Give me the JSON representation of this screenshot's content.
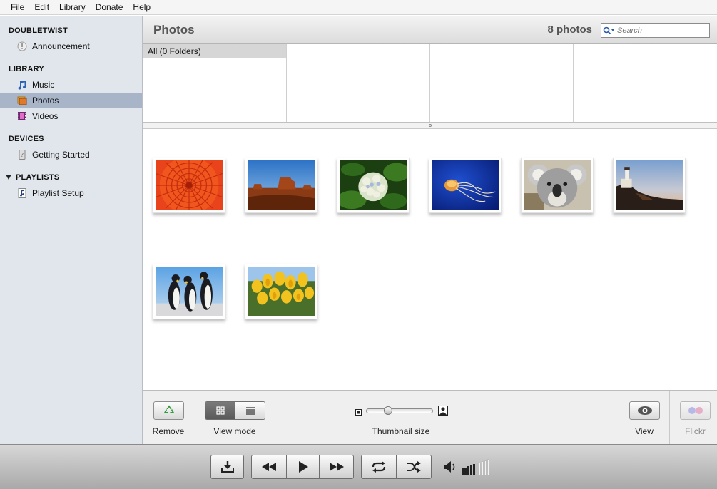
{
  "menu": [
    "File",
    "Edit",
    "Library",
    "Donate",
    "Help"
  ],
  "sidebar": {
    "sections": [
      {
        "title": "DOUBLETWIST",
        "items": [
          {
            "label": "Announcement",
            "icon": "announcement-icon"
          }
        ]
      },
      {
        "title": "LIBRARY",
        "items": [
          {
            "label": "Music",
            "icon": "music-note-icon"
          },
          {
            "label": "Photos",
            "icon": "photos-icon",
            "active": true
          },
          {
            "label": "Videos",
            "icon": "film-icon"
          }
        ]
      },
      {
        "title": "DEVICES",
        "items": [
          {
            "label": "Getting Started",
            "icon": "device-question-icon"
          }
        ]
      },
      {
        "title": "PLAYLISTS",
        "collapsible": true,
        "items": [
          {
            "label": "Playlist Setup",
            "icon": "playlist-icon"
          }
        ]
      }
    ]
  },
  "header": {
    "title": "Photos",
    "count": "8 photos",
    "search_placeholder": "Search"
  },
  "browser": {
    "first_row": "All (0 Folders)"
  },
  "photos": [
    {
      "subject": "orange-flower"
    },
    {
      "subject": "desert-butte"
    },
    {
      "subject": "hydrangea"
    },
    {
      "subject": "jellyfish"
    },
    {
      "subject": "koala"
    },
    {
      "subject": "lighthouse"
    },
    {
      "subject": "penguins"
    },
    {
      "subject": "tulips"
    }
  ],
  "toolbar": {
    "remove_label": "Remove",
    "view_mode_label": "View mode",
    "thumbnail_size_label": "Thumbnail size",
    "thumbnail_size_value": 0.3,
    "view_label": "View",
    "flickr_label": "Flickr"
  },
  "player": {
    "volume_level": 0.5
  },
  "colors": {
    "sidebar_bg": "#e1e6ec",
    "sidebar_active": "#a8b4c8",
    "recycle_green": "#2e9b3a"
  }
}
